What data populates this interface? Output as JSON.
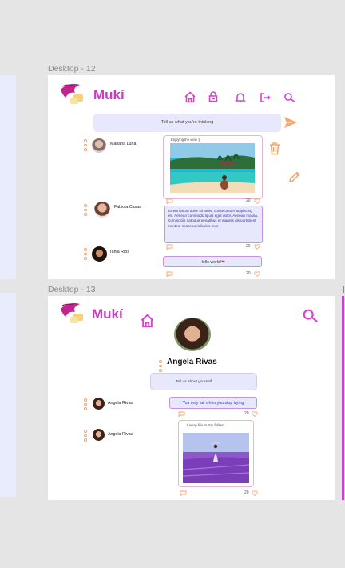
{
  "frames": [
    {
      "label": "Desktop - 12",
      "brand": "Mukí",
      "composer_placeholder": "Tell us what you're thinking",
      "posts": [
        {
          "user": "Mariana Luna",
          "caption": "Enjoying the view :)",
          "count": "20"
        },
        {
          "user": "Fabiola Casas",
          "text": "Lorem ipsum dolor sit amet, consectetuer adipiscing elit. Aenean commodo ligula eget dolor. Aenean massa. Cum sociis natoque penatibus et magnis dis parturient montes, nascetur ridiculus mus",
          "count": "20"
        },
        {
          "user": "Tania Ríos",
          "text": "Hello world!",
          "count": "20"
        }
      ]
    },
    {
      "label": "Desktop - 13",
      "brand": "Mukí",
      "profile_name": "Angela Rivas",
      "bio_placeholder": "Tell us about yourself.",
      "posts": [
        {
          "user": "Angela Rivas",
          "text": "You only fail when you stop trying",
          "count": "20"
        },
        {
          "user": "Angela Rivas",
          "caption": "Living life to my fullest",
          "count": "20"
        }
      ]
    }
  ],
  "colors": {
    "accent": "#d243cf",
    "send_icon": "#f3a66e",
    "background": "#e5e5e5",
    "frame": "#ffffff",
    "input_fill": "#e7e8fb"
  },
  "icons": [
    "home-icon",
    "lock-icon",
    "bell-icon",
    "logout-icon",
    "search-icon",
    "send-icon",
    "trash-icon",
    "pencil-icon",
    "comment-icon",
    "heart-icon"
  ]
}
